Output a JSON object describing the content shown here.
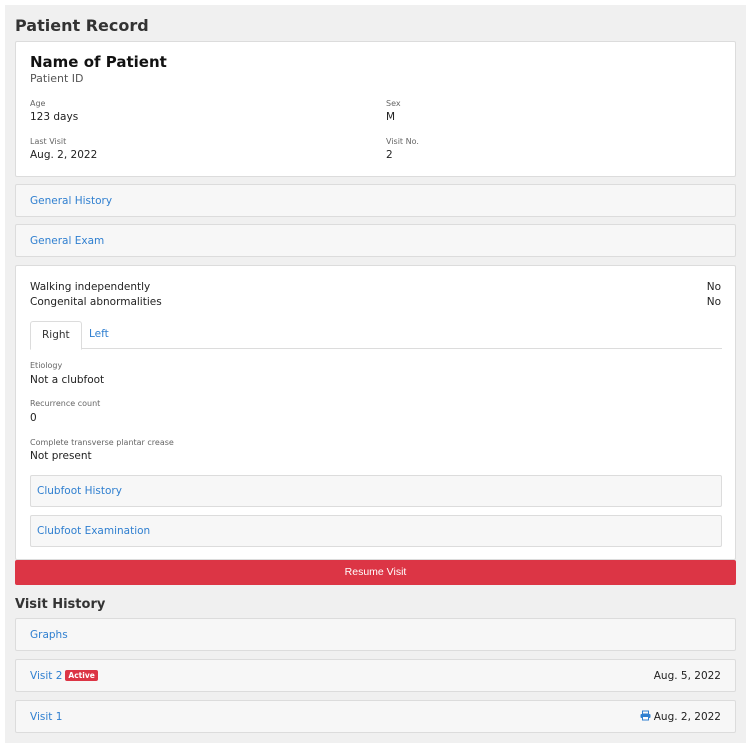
{
  "header": {
    "title": "Patient Record"
  },
  "patient": {
    "name": "Name of Patient",
    "id_label": "Patient ID",
    "age_label": "Age",
    "age_value": "123 days",
    "sex_label": "Sex",
    "sex_value": "M",
    "last_visit_label": "Last Visit",
    "last_visit_value": "Aug. 2, 2022",
    "visit_no_label": "Visit No.",
    "visit_no_value": "2"
  },
  "sections": {
    "general_history": "General History",
    "general_exam": "General Exam"
  },
  "exam": {
    "walking_label": "Walking independently",
    "walking_value": "No",
    "congenital_label": "Congenital abnormalities",
    "congenital_value": "No",
    "tabs": [
      "Right",
      "Left"
    ],
    "etiology_label": "Etiology",
    "etiology_value": "Not a clubfoot",
    "recurrence_label": "Recurrence count",
    "recurrence_value": "0",
    "crease_label": "Complete transverse plantar crease",
    "crease_value": "Not present",
    "clubfoot_history": "Clubfoot History",
    "clubfoot_exam": "Clubfoot Examination"
  },
  "actions": {
    "resume": "Resume Visit"
  },
  "visit_history": {
    "title": "Visit History",
    "graphs": "Graphs",
    "visits": [
      {
        "label": "Visit 2",
        "badge": "Active",
        "date": "Aug. 5, 2022"
      },
      {
        "label": "Visit 1",
        "date": "Aug. 2, 2022",
        "icon": "print-icon"
      }
    ]
  },
  "colors": {
    "accent": "#dc3545",
    "link": "#2f7fd0",
    "background": "#f0f0f0"
  }
}
